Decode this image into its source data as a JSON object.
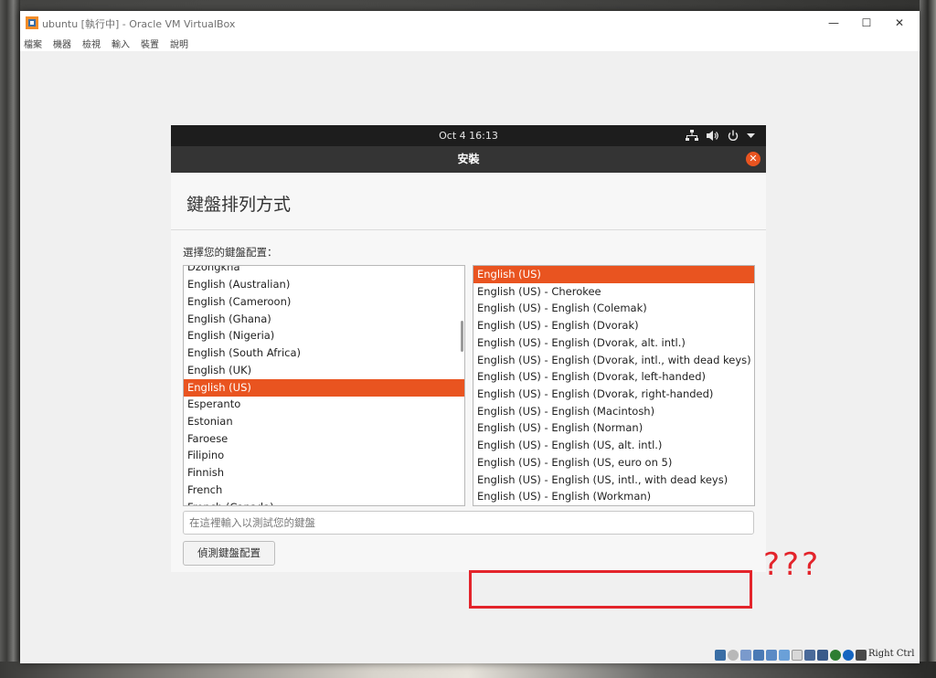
{
  "window": {
    "title": "ubuntu [執行中] - Oracle VM VirtualBox",
    "min": "—",
    "max": "☐",
    "close": "✕"
  },
  "menu": [
    "檔案",
    "機器",
    "檢視",
    "輸入",
    "裝置",
    "說明"
  ],
  "topbar": {
    "clock": "Oct 4  16:13",
    "network_icon": "network-icon",
    "volume_icon": "volume-icon",
    "power_icon": "power-icon"
  },
  "header": {
    "title": "安裝",
    "close": "✕"
  },
  "page": {
    "title": "鍵盤排列方式",
    "prompt": "選擇您的鍵盤配置：",
    "test_placeholder": "在這裡輸入以測試您的鍵盤",
    "detect_label": "偵測鍵盤配置"
  },
  "layouts": [
    "Dzongkha",
    "English (Australian)",
    "English (Cameroon)",
    "English (Ghana)",
    "English (Nigeria)",
    "English (South Africa)",
    "English (UK)",
    "English (US)",
    "Esperanto",
    "Estonian",
    "Faroese",
    "Filipino",
    "Finnish",
    "French",
    "French (Canada)"
  ],
  "layouts_selected": "English (US)",
  "variants": [
    "English (US)",
    "English (US) - Cherokee",
    "English (US) - English (Colemak)",
    "English (US) - English (Dvorak)",
    "English (US) - English (Dvorak, alt. intl.)",
    "English (US) - English (Dvorak, intl., with dead keys)",
    "English (US) - English (Dvorak, left-handed)",
    "English (US) - English (Dvorak, right-handed)",
    "English (US) - English (Macintosh)",
    "English (US) - English (Norman)",
    "English (US) - English (US, alt. intl.)",
    "English (US) - English (US, euro on 5)",
    "English (US) - English (US, intl., with dead keys)",
    "English (US) - English (Workman)"
  ],
  "variants_selected": "English (US)",
  "annotation": {
    "text": "???",
    "color": "#e3242b"
  },
  "status": {
    "host_key": "Right Ctrl"
  },
  "colors": {
    "accent": "#e95420",
    "topbar": "#1d1d1d",
    "headerbar": "#343434"
  }
}
